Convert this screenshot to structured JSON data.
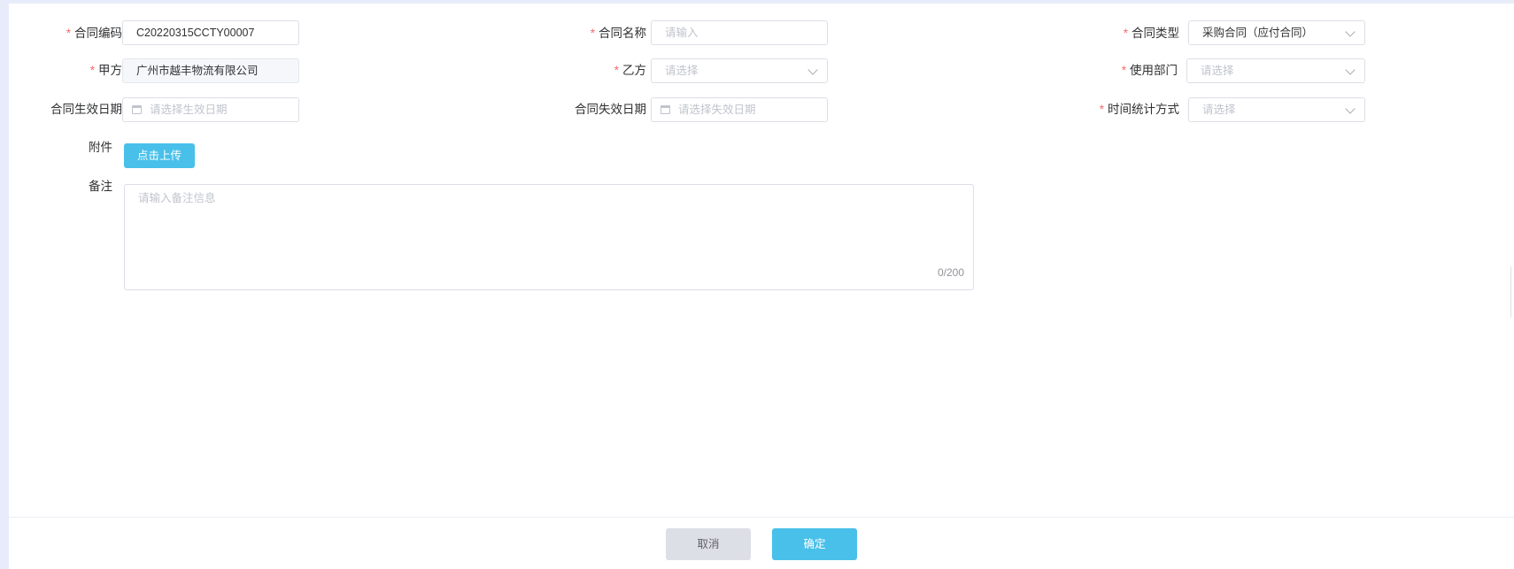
{
  "form": {
    "contract_code": {
      "label": "合同编码",
      "required": true,
      "value": "C20220315CCTY00007"
    },
    "contract_name": {
      "label": "合同名称",
      "required": true,
      "value": "",
      "placeholder": "请输入"
    },
    "contract_type": {
      "label": "合同类型",
      "required": true,
      "value": "采购合同（应付合同）",
      "options_visible": [
        "采购合同（应付合同）"
      ]
    },
    "party_a": {
      "label": "甲方",
      "required": true,
      "value": "广州市越丰物流有限公司",
      "disabled": true
    },
    "party_b": {
      "label": "乙方",
      "required": true,
      "value": "",
      "placeholder": "请选择"
    },
    "department": {
      "label": "使用部门",
      "required": true,
      "value": "",
      "placeholder": "请选择"
    },
    "effective_date": {
      "label": "合同生效日期",
      "required": false,
      "value": "",
      "placeholder": "请选择生效日期"
    },
    "expiry_date": {
      "label": "合同失效日期",
      "required": false,
      "value": "",
      "placeholder": "请选择失效日期"
    },
    "time_stat_method": {
      "label": "时间统计方式",
      "required": true,
      "value": "",
      "placeholder": "请选择"
    },
    "attachment": {
      "label": "附件",
      "button_label": "点击上传"
    },
    "remark": {
      "label": "备注",
      "value": "",
      "placeholder": "请输入备注信息",
      "counter": "0/200"
    }
  },
  "footer": {
    "cancel_label": "取消",
    "confirm_label": "确定"
  },
  "colors": {
    "primary": "#49c0ea",
    "required_mark": "#f56c6c",
    "page_bg": "#e8ecfa"
  },
  "icons": [
    "calendar-icon",
    "chevron-down-icon"
  ]
}
